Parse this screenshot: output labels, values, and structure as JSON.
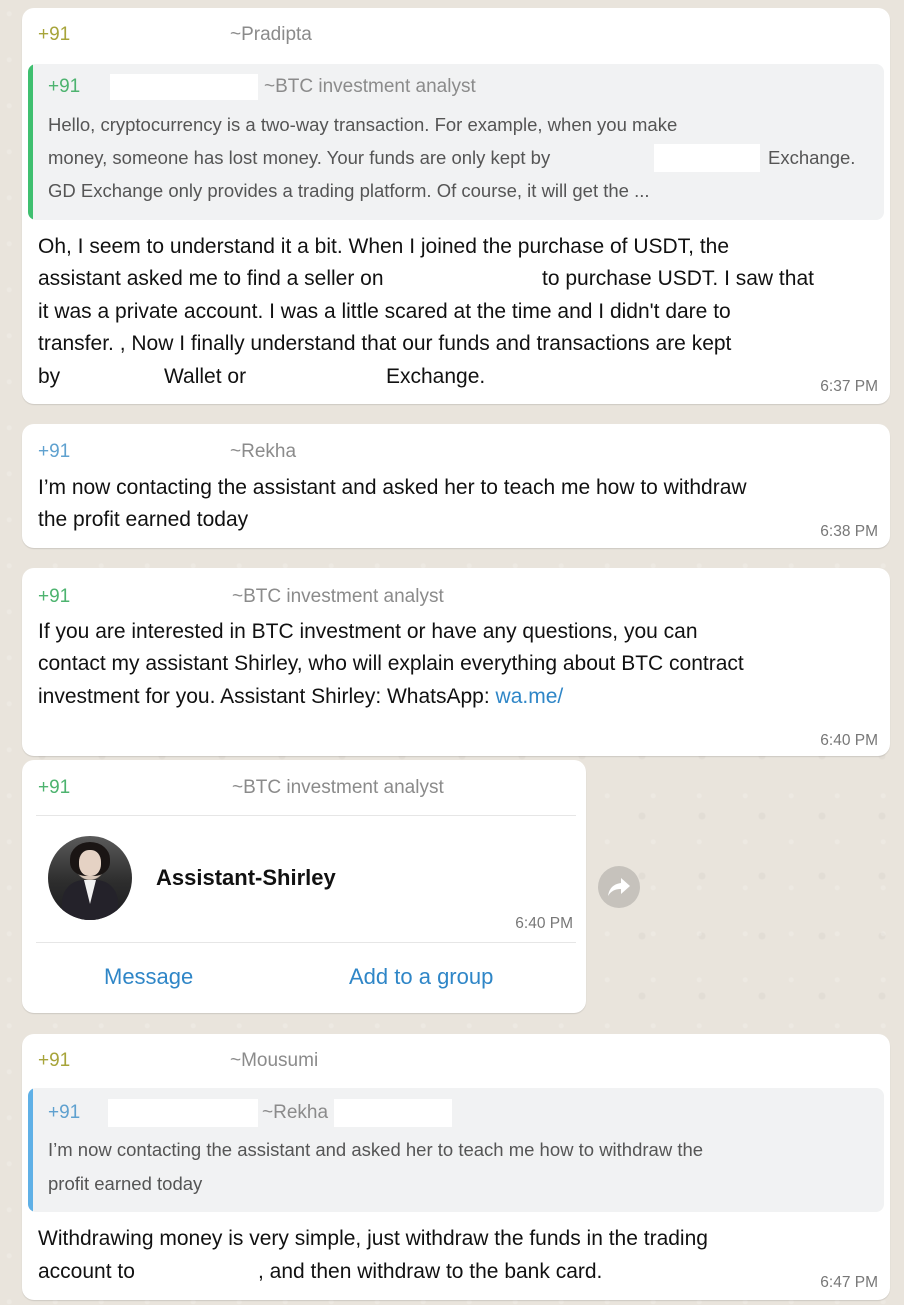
{
  "messages": [
    {
      "phone": "+91",
      "sender": "~Pradipta",
      "quote": {
        "phone": "+91",
        "sender": "~BTC investment analyst",
        "lines": [
          "Hello, cryptocurrency is a two-way transaction. For example, when you make",
          "money, someone has lost money. Your funds are only kept by",
          "GD Exchange only provides a trading platform. Of course, it will get the ..."
        ],
        "line2_tail": "Exchange."
      },
      "lines": [
        "Oh, I seem to understand it a bit. When I joined the purchase of USDT, the",
        "assistant asked me to find a seller on",
        "it was a private account. I was a little scared at the time and I didn't dare to",
        "transfer. , Now I finally understand that our funds and transactions are kept",
        "by"
      ],
      "line2_tail": "to purchase USDT. I saw that",
      "line5_mid": "Wallet or",
      "line5_tail": "Exchange.",
      "time": "6:37 PM"
    },
    {
      "phone": "+91",
      "sender": "~Rekha",
      "lines": [
        "I’m now contacting the assistant and asked her to teach me how to withdraw",
        "the profit earned today"
      ],
      "time": "6:38 PM"
    },
    {
      "phone": "+91",
      "sender": "~BTC investment analyst",
      "lines": [
        "If you are interested in BTC investment or have any questions, you can",
        "contact my assistant Shirley, who will explain everything about BTC contract",
        "investment for you. Assistant Shirley: WhatsApp:"
      ],
      "link": "wa.me/",
      "time": "6:40 PM"
    },
    {
      "phone": "+91",
      "sender": "~BTC investment analyst",
      "contact_name": "Assistant-Shirley",
      "time": "6:40 PM",
      "actions": {
        "message": "Message",
        "add_group": "Add to a group"
      }
    },
    {
      "phone": "+91",
      "sender": "~Mousumi",
      "quote": {
        "phone": "+91",
        "sender": "~Rekha",
        "lines": [
          "I’m now contacting the assistant and asked her to teach me how to withdraw the",
          "profit earned today"
        ]
      },
      "lines": [
        "Withdrawing money is very simple, just withdraw the funds in the trading",
        "account to"
      ],
      "line2_tail": ", and then withdraw to the bank card.",
      "time": "6:47 PM"
    }
  ],
  "icons": {
    "avatar": "contact-avatar-photo",
    "forward": "forward-arrow-icon"
  },
  "colors": {
    "background": "#e9e4dc",
    "bubble": "#ffffff",
    "quote_bg": "#f1f2f3",
    "green_bar": "#3fbf6f",
    "blue_bar": "#5fb0e6",
    "link": "#2f86c7"
  }
}
